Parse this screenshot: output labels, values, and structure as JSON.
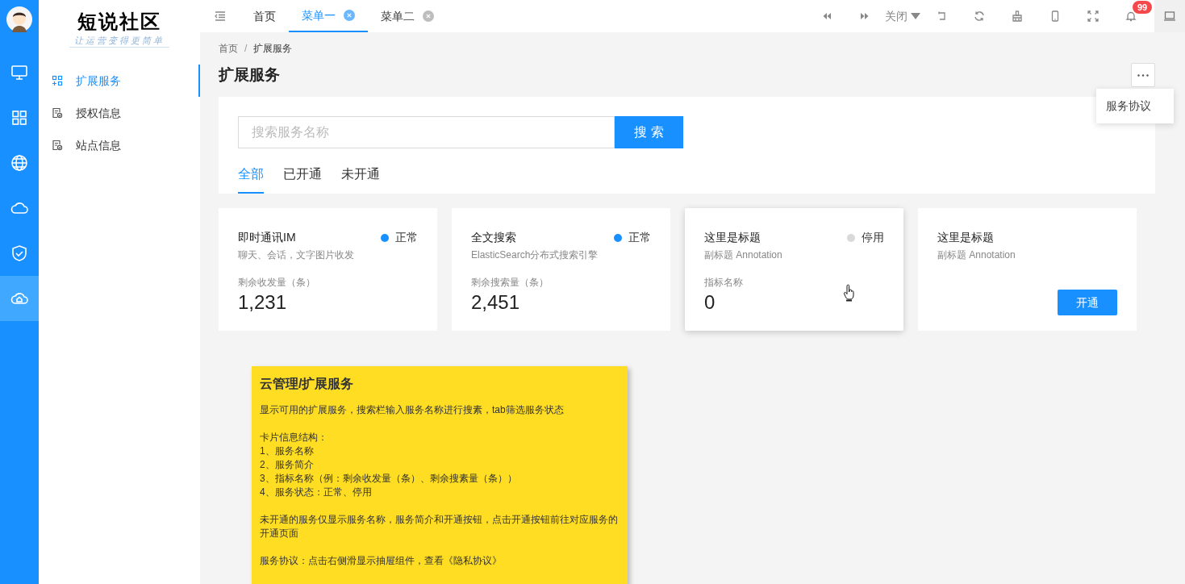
{
  "rail": {
    "items": [
      {
        "selected": false
      },
      {
        "selected": false
      },
      {
        "selected": false
      },
      {
        "selected": false
      },
      {
        "selected": false
      },
      {
        "selected": true
      }
    ]
  },
  "logo": {
    "title": "短说社区",
    "slogan": "让运营变得更简单"
  },
  "nav": [
    {
      "label": "扩展服务",
      "selected": true
    },
    {
      "label": "授权信息",
      "selected": false
    },
    {
      "label": "站点信息",
      "selected": false
    }
  ],
  "tabs": [
    {
      "label": "首页",
      "selected": false,
      "closable": false
    },
    {
      "label": "菜单一",
      "selected": true,
      "closable": true
    },
    {
      "label": "菜单二",
      "selected": false,
      "closable": true
    }
  ],
  "toolbar": {
    "close_label": "关闭",
    "notification_count": "99"
  },
  "breadcrumb": {
    "items": [
      "首页",
      "扩展服务"
    ],
    "separator": "/"
  },
  "page_title": "扩展服务",
  "more_menu": {
    "items": [
      "服务协议"
    ]
  },
  "search": {
    "placeholder": "搜索服务名称",
    "button": "搜 索"
  },
  "filter_tabs": [
    {
      "label": "全部",
      "selected": true
    },
    {
      "label": "已开通",
      "selected": false
    },
    {
      "label": "未开通",
      "selected": false
    }
  ],
  "cards": [
    {
      "kind": "metric",
      "title": "即时通讯IM",
      "subtitle": "聊天、会话，文字图片收发",
      "status": {
        "label": "正常",
        "color": "#1890ff"
      },
      "metric_label": "剩余收发量（条）",
      "value": "1,231",
      "hovered": false
    },
    {
      "kind": "metric",
      "title": "全文搜索",
      "subtitle": "ElasticSearch分布式搜索引擎",
      "status": {
        "label": "正常",
        "color": "#1890ff"
      },
      "metric_label": "剩余搜索量（条）",
      "value": "2,451",
      "hovered": false
    },
    {
      "kind": "metric",
      "title": "这里是标题",
      "subtitle": "副标题 Annotation",
      "status": {
        "label": "停用",
        "color": "#d9d9d9"
      },
      "metric_label": "指标名称",
      "value": "0",
      "hovered": true
    },
    {
      "kind": "inactive",
      "title": "这里是标题",
      "subtitle": "副标题 Annotation",
      "button": "开通",
      "hovered": false
    }
  ],
  "note": {
    "title": "云管理/扩展服务",
    "paragraphs": [
      "显示可用的扩展服务，搜索栏输入服务名称进行搜素，tab筛选服务状态",
      "卡片信息结构：\n1、服务名称\n2、服务简介\n3、指标名称（例：剩余收发量（条）、剩余搜素量（条））\n4、服务状态：正常、停用",
      "未开通的服务仅显示服务名称，服务简介和开通按钮，点击开通按钮前往对应服务的开通页面",
      "服务协议：点击右侧滑显示抽屉组件，查看《隐私协议》"
    ]
  }
}
